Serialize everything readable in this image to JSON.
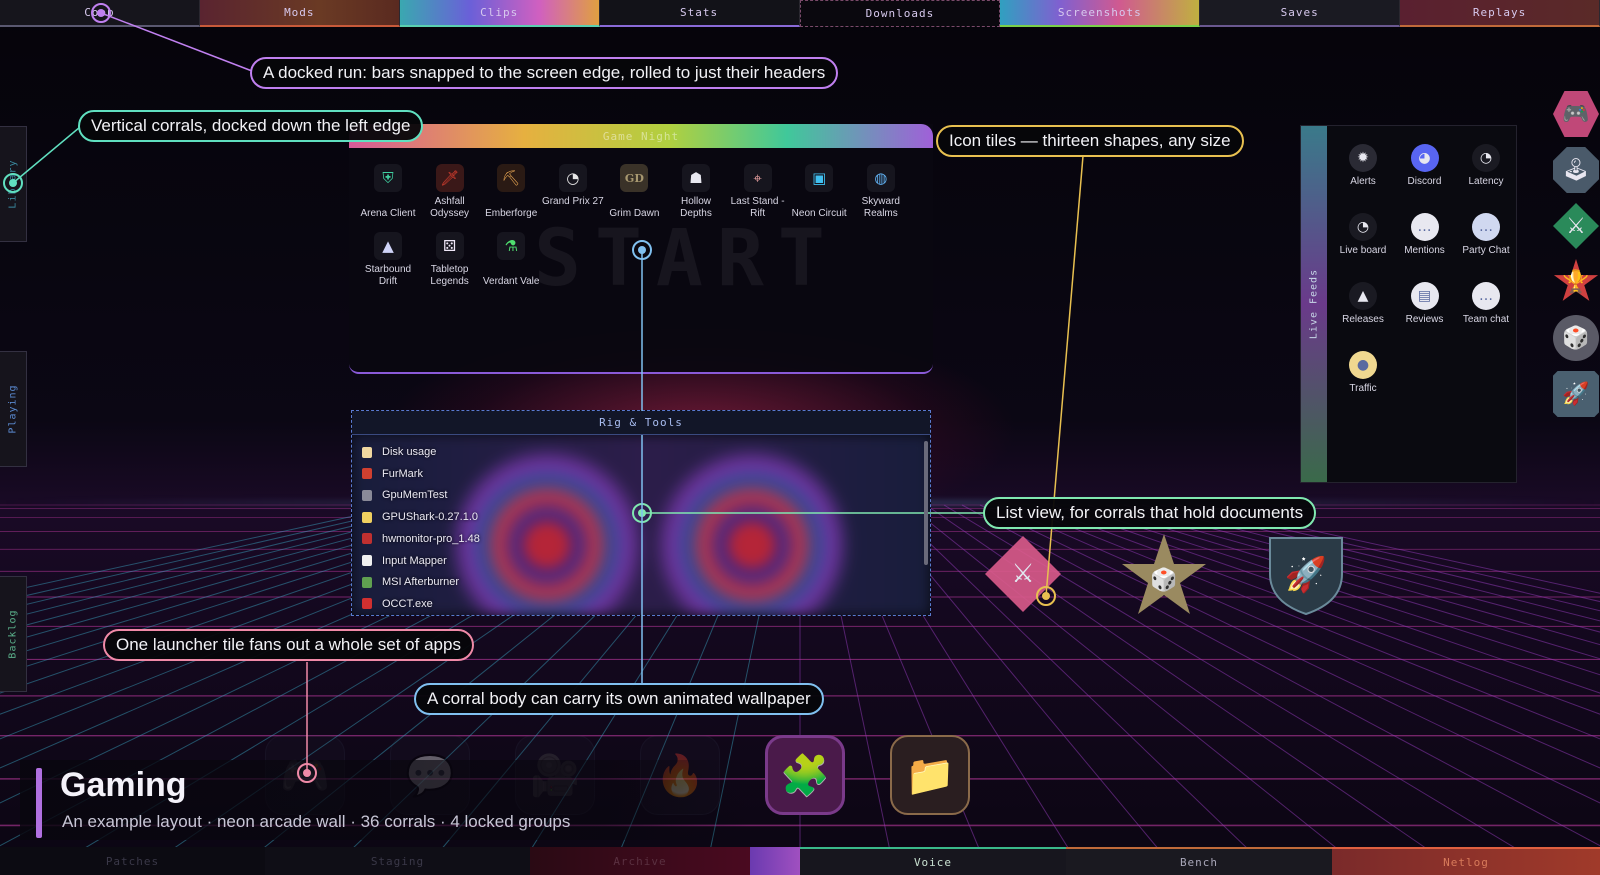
{
  "top_tabs": [
    {
      "label": "Coop",
      "color": "#5a5870",
      "bg": "#16151c"
    },
    {
      "label": "Mods",
      "color": "#c85a3a",
      "bg": "linear-gradient(90deg,#5a2430,#6a3a24 60%,#5a2a20)"
    },
    {
      "label": "Clips",
      "color": "#5ad0b0",
      "bg": "linear-gradient(90deg,#3aa8b0,#6a60d8 35%,#d060c0 70%,#e0a040)"
    },
    {
      "label": "Stats",
      "color": "#8a6ad8",
      "bg": "#121218"
    },
    {
      "label": "Downloads",
      "color": "#7a4a6a",
      "bg": "#0a080e"
    },
    {
      "label": "Screenshots",
      "color": "#7ad04a",
      "bg": "linear-gradient(90deg,#30a0c0,#8060d0 30%,#d05a90 60%,#c0b040)"
    },
    {
      "label": "Saves",
      "color": "#6a5890",
      "bg": "#1a1a22"
    },
    {
      "label": "Replays",
      "color": "#c06a3a",
      "bg": "linear-gradient(90deg,#5a2030,#5a2a28)"
    }
  ],
  "bottom_tabs": [
    {
      "label": "Patches"
    },
    {
      "label": "Staging"
    },
    {
      "label": "Archive"
    },
    {
      "label": "Voice"
    },
    {
      "label": "Bench"
    },
    {
      "label": "Netlog"
    }
  ],
  "left_corrals": [
    "Library",
    "Playing",
    "Backlog"
  ],
  "game_night": {
    "title": "Game Night",
    "watermark": "START",
    "tiles": [
      {
        "label": "Arena Client",
        "icon": "shield-icon",
        "glyph": "⛨",
        "color": "#40d0a0"
      },
      {
        "label": "Ashfall Odyssey",
        "icon": "sword-icon",
        "glyph": "🗡",
        "color": "#e04030"
      },
      {
        "label": "Emberforge",
        "icon": "pickaxe-icon",
        "glyph": "⛏",
        "color": "#e0a050"
      },
      {
        "label": "Grand Prix 27",
        "icon": "speedometer-icon",
        "glyph": "◔",
        "color": "#e8e8e8"
      },
      {
        "label": "Grim Dawn",
        "icon": "gd-logo-icon",
        "glyph": "GD",
        "color": "#a89870"
      },
      {
        "label": "Hollow Depths",
        "icon": "ghost-icon",
        "glyph": "☗",
        "color": "#e8e8f0"
      },
      {
        "label": "Last Stand - Rift",
        "icon": "crosshair-icon",
        "glyph": "⌖",
        "color": "#e8a0a0"
      },
      {
        "label": "Neon Circuit",
        "icon": "chip-icon",
        "glyph": "▣",
        "color": "#40c0f0"
      },
      {
        "label": "Skyward Realms",
        "icon": "globe-icon",
        "glyph": "◍",
        "color": "#60b0f0"
      },
      {
        "label": "Starbound Drift",
        "icon": "rocket-icon",
        "glyph": "▲",
        "color": "#d0d4f8"
      },
      {
        "label": "Tabletop Legends",
        "icon": "dice-icon",
        "glyph": "⚄",
        "color": "#f0e8f8"
      },
      {
        "label": "Verdant Vale",
        "icon": "flask-icon",
        "glyph": "⚗",
        "color": "#50e070"
      }
    ]
  },
  "rig_tools": {
    "title": "Rig & Tools",
    "files": [
      {
        "name": "Disk usage",
        "color": "#f0d8a0"
      },
      {
        "name": "FurMark",
        "color": "#d04030"
      },
      {
        "name": "GpuMemTest",
        "color": "#8a8a98"
      },
      {
        "name": "GPUShark-0.27.1.0",
        "color": "#f0d060"
      },
      {
        "name": "hwmonitor-pro_1.48",
        "color": "#c03030"
      },
      {
        "name": "Input Mapper",
        "color": "#f0f0f0"
      },
      {
        "name": "MSI Afterburner",
        "color": "#60a050"
      },
      {
        "name": "OCCT.exe",
        "color": "#d03030"
      }
    ]
  },
  "live_feeds": {
    "title": "Live Feeds",
    "tiles": [
      {
        "label": "Alerts",
        "icon": "bug-icon",
        "glyph": "✹",
        "bg": "#2a2a34"
      },
      {
        "label": "Discord",
        "icon": "discord-icon",
        "glyph": "◕",
        "bg": "#5865f2"
      },
      {
        "label": "Latency",
        "icon": "gauge-icon",
        "glyph": "◔",
        "bg": "#1a1a22"
      },
      {
        "label": "Live board",
        "icon": "speedometer-icon",
        "glyph": "◔",
        "bg": "#1a1a22"
      },
      {
        "label": "Mentions",
        "icon": "chat-bubble-icon",
        "glyph": "…",
        "bg": "#e8e8f0"
      },
      {
        "label": "Party Chat",
        "icon": "chat-bubble-icon",
        "glyph": "…",
        "bg": "#d0d8f0"
      },
      {
        "label": "Releases",
        "icon": "rocket-icon",
        "glyph": "▲",
        "bg": "#1a1a22"
      },
      {
        "label": "Reviews",
        "icon": "document-icon",
        "glyph": "▤",
        "bg": "#e8e8f0"
      },
      {
        "label": "Team chat",
        "icon": "chat-bubble-icon",
        "glyph": "…",
        "bg": "#e8e8f0"
      },
      {
        "label": "Traffic",
        "icon": "sun-icon",
        "glyph": "●",
        "bg": "#f0d890"
      }
    ]
  },
  "right_shapes": [
    {
      "icon": "gamepad-icon",
      "glyph": "🎮",
      "bg": "#c04878"
    },
    {
      "icon": "joystick-icon",
      "glyph": "🕹",
      "bg": "#4a5a6a"
    },
    {
      "icon": "swords-icon",
      "glyph": "⚔",
      "bg": "#2a8a5a"
    },
    {
      "icon": "trophy-icon",
      "glyph": "🏆",
      "bg": "#d04040"
    },
    {
      "icon": "dice-icon",
      "glyph": "🎲",
      "bg": "#5a5a66"
    },
    {
      "icon": "rocket-icon",
      "glyph": "🚀",
      "bg": "#4a6070"
    }
  ],
  "floating_shapes": [
    {
      "icon": "swords-icon",
      "glyph": "⚔"
    },
    {
      "icon": "dice-icon",
      "glyph": "🎲"
    },
    {
      "icon": "rocket-icon",
      "glyph": "🚀"
    }
  ],
  "dock": [
    {
      "icon": "gamepad-icon",
      "glyph": "🎮",
      "dim": true
    },
    {
      "icon": "chat-icon",
      "glyph": "💬",
      "dim": true
    },
    {
      "icon": "video-camera-icon",
      "glyph": "🎥",
      "dim": true
    },
    {
      "icon": "flame-icon",
      "glyph": "🔥",
      "dim": true
    },
    {
      "icon": "puzzle-icon",
      "glyph": "🧩",
      "dim": false
    },
    {
      "icon": "folder-icon",
      "glyph": "📁",
      "dim": false
    }
  ],
  "caption": {
    "title": "Gaming",
    "subtitle": "An example layout · neon arcade wall · 36 corrals · 4 locked groups"
  },
  "callouts": {
    "docked_run": "A docked run: bars snapped to the screen edge, rolled to just their headers",
    "vertical": "Vertical corrals, docked down the left edge",
    "icon_tiles": "Icon tiles — thirteen shapes, any size",
    "list_view": "List view, for corrals that hold documents",
    "launcher": "One launcher tile fans out a whole set of apps",
    "wallpaper": "A corral body can carry its own animated wallpaper"
  },
  "colors": {
    "purple_callout": "#c080f0",
    "teal_callout": "#60e0c0",
    "gold_callout": "#e8c050",
    "green_callout": "#80e8b0",
    "pink_callout": "#f08aa8",
    "blue_callout": "#80c0f0"
  }
}
